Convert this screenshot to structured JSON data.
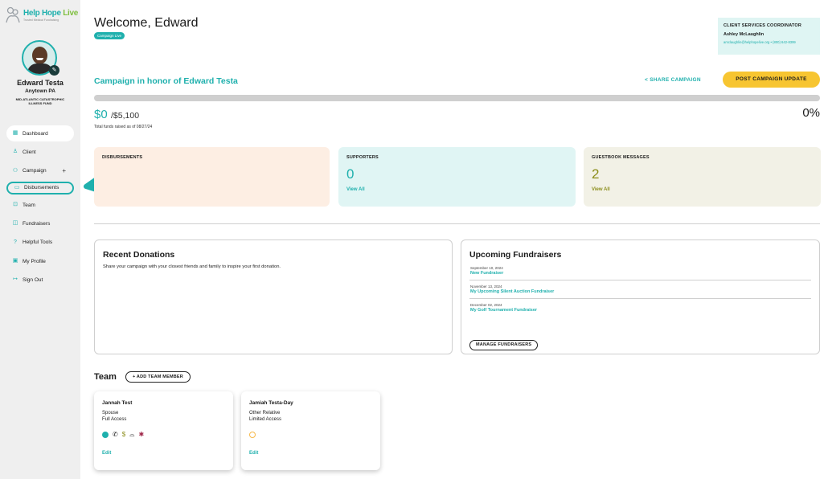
{
  "brand": {
    "name_part1": "Help Hope",
    "name_part2": "Live",
    "tagline": "Trusted Medical Fundraising"
  },
  "user": {
    "name": "Edward Testa",
    "location": "Anytown PA",
    "fund": "MID-ATLANTIC CATASTROPHIC ILLNESS FUND"
  },
  "nav": {
    "items": [
      {
        "label": "Dashboard",
        "icon": "grid-icon"
      },
      {
        "label": "Client",
        "icon": "person-icon"
      },
      {
        "label": "Campaign",
        "icon": "people-icon"
      },
      {
        "label": "Disbursements",
        "icon": "money-icon"
      },
      {
        "label": "Team",
        "icon": "team-icon"
      },
      {
        "label": "Fundraisers",
        "icon": "gift-icon"
      },
      {
        "label": "Helpful Tools",
        "icon": "help-icon"
      },
      {
        "label": "My Profile",
        "icon": "profile-icon"
      },
      {
        "label": "Sign Out",
        "icon": "signout-icon"
      }
    ],
    "campaign_plus": "+"
  },
  "header": {
    "welcome": "Welcome, Edward",
    "status_pill": "Campaign Live"
  },
  "coordinator": {
    "title": "CLIENT SERVICES COORDINATOR",
    "name": "Ashley McLaughlin",
    "contact": "amclaughlin@helphopelive.org • (800) 642-8399"
  },
  "campaign": {
    "title": "Campaign in honor of Edward Testa",
    "share_label": "SHARE CAMPAIGN",
    "post_update_label": "POST CAMPAIGN UPDATE",
    "raised": "$0",
    "goal": "/$5,100",
    "percent": "0%",
    "progress_fraction": 0,
    "as_of": "Total funds raised as of 08/27/24"
  },
  "stats": {
    "disbursements": {
      "label": "DISBURSEMENTS"
    },
    "supporters": {
      "label": "SUPPORTERS",
      "value": "0",
      "link": "View All"
    },
    "guestbook": {
      "label": "GUESTBOOK MESSAGES",
      "value": "2",
      "link": "View All"
    }
  },
  "recent_donations": {
    "title": "Recent Donations",
    "text": "Share your campaign with your closest friends and family to inspire your first donation."
  },
  "upcoming_fundraisers": {
    "title": "Upcoming Fundraisers",
    "items": [
      {
        "date": "September 10, 2024",
        "name": "New Fundraiser"
      },
      {
        "date": "November 13, 2024",
        "name": "My Upcoming Silent Auction Fundraiser"
      },
      {
        "date": "December 02, 2024",
        "name": "My Golf Tournament Fundraiser"
      }
    ],
    "manage_label": "MANAGE FUNDRAISERS"
  },
  "team": {
    "title": "Team",
    "add_label": "+ ADD TEAM MEMBER",
    "members": [
      {
        "name": "Jannah Test",
        "relation": "Spouse",
        "access": "Full Access",
        "edit": "Edit"
      },
      {
        "name": "Jamiah Testa-Day",
        "relation": "Other Relative",
        "access": "Limited Access",
        "edit": "Edit"
      }
    ]
  },
  "colors": {
    "accent": "#1fb0ad",
    "button_yellow": "#f7c531",
    "sidebar_bg": "#efefef"
  }
}
